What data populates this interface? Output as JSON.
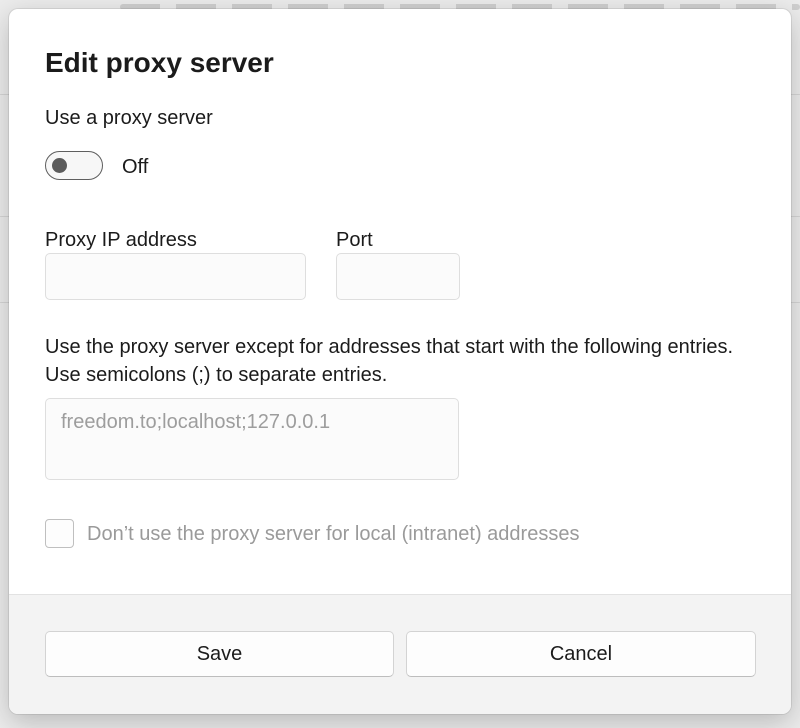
{
  "dialog": {
    "title": "Edit proxy server",
    "use_proxy_label": "Use a proxy server",
    "toggle": {
      "state_label": "Off",
      "on": false
    },
    "ip_field": {
      "label": "Proxy IP address",
      "value": ""
    },
    "port_field": {
      "label": "Port",
      "value": ""
    },
    "exceptions": {
      "line1": "Use the proxy server except for addresses that start with the following entries.",
      "line2": "Use semicolons (;) to separate entries.",
      "placeholder": "freedom.to;localhost;127.0.0.1",
      "value": ""
    },
    "local_checkbox": {
      "label": "Don’t use the proxy server for local (intranet) addresses",
      "checked": false
    },
    "buttons": {
      "save": "Save",
      "cancel": "Cancel"
    }
  }
}
